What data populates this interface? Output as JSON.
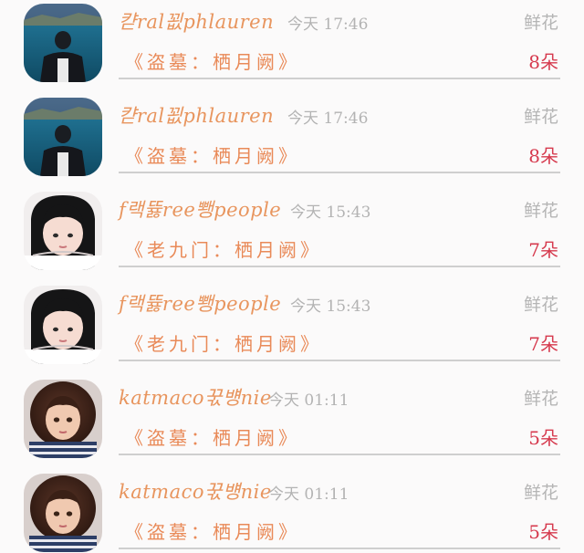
{
  "rows": [
    {
      "name": "캳ral꾒phlauren",
      "time": "今天 17:46",
      "gift_label": "鲜花",
      "work": "《盗墓：栖月阙》",
      "count": "8朵",
      "avatar": "man-by-lake"
    },
    {
      "name": "캳ral꾒phlauren",
      "time": "今天 17:46",
      "gift_label": "鲜花",
      "work": "《盗墓：栖月阙》",
      "count": "8朵",
      "avatar": "man-by-lake"
    },
    {
      "name": "f랙뜛ree뾍people",
      "time": "今天 15:43",
      "gift_label": "鲜花",
      "work": "《老九门：栖月阙》",
      "count": "7朵",
      "avatar": "girl-dark-hair"
    },
    {
      "name": "f랙뜛ree뾍people",
      "time": "今天 15:43",
      "gift_label": "鲜花",
      "work": "《老九门：栖月阙》",
      "count": "7朵",
      "avatar": "girl-dark-hair"
    },
    {
      "name": "katmaco꾻뱽nie",
      "time": "今天 01:11",
      "gift_label": "鲜花",
      "work": "《盗墓：栖月阙》",
      "count": "5朵",
      "avatar": "curly-child"
    },
    {
      "name": "katmaco꾻뱽nie",
      "time": "今天 01:11",
      "gift_label": "鲜花",
      "work": "《盗墓：栖月阙》",
      "count": "5朵",
      "avatar": "curly-child"
    }
  ]
}
